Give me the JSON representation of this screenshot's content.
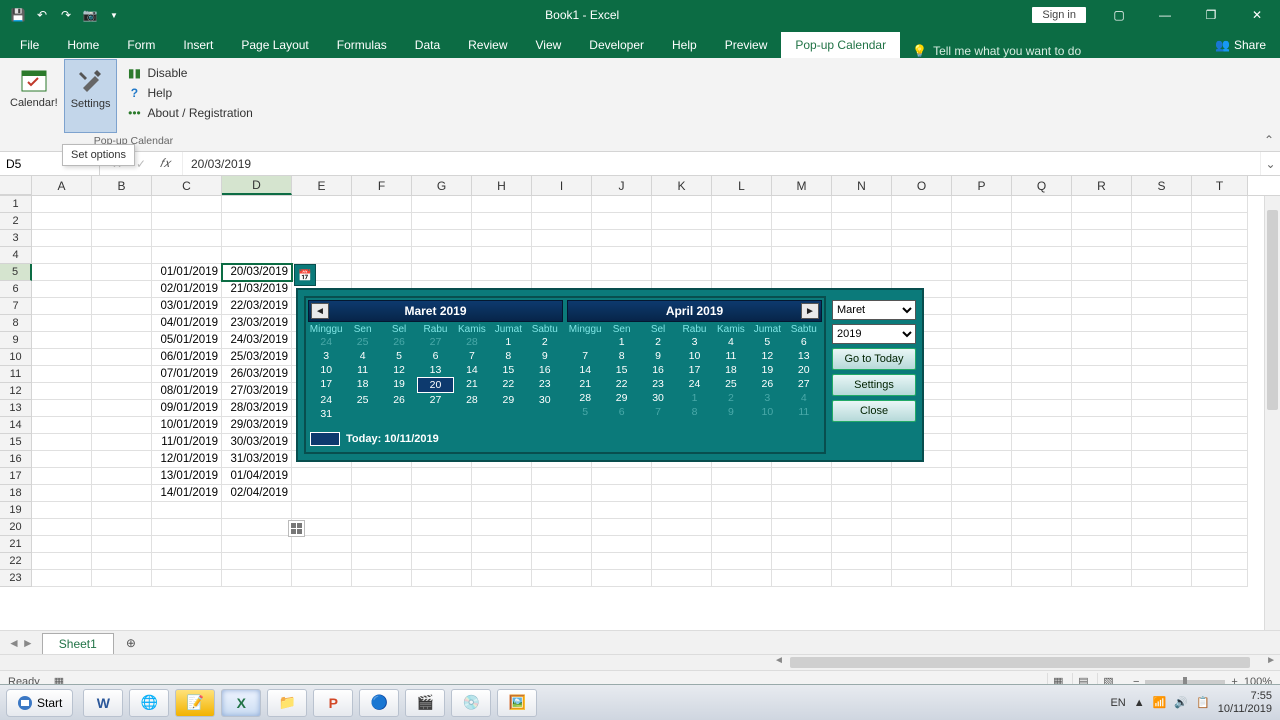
{
  "titlebar": {
    "title": "Book1 - Excel",
    "signin": "Sign in"
  },
  "tabs": {
    "file": "File",
    "items": [
      "Home",
      "Form",
      "Insert",
      "Page Layout",
      "Formulas",
      "Data",
      "Review",
      "View",
      "Developer",
      "Help",
      "Preview",
      "Pop-up Calendar"
    ],
    "active": "Pop-up Calendar",
    "tellme": "Tell me what you want to do",
    "share": "Share"
  },
  "ribbon": {
    "btn_calendar": "Calendar!",
    "btn_settings": "Settings",
    "menu_disable": "Disable",
    "menu_help": "Help",
    "menu_about": "About / Registration",
    "group_label": "Pop-up Calendar",
    "tooltip": "Set options"
  },
  "formula": {
    "namebox": "D5",
    "fx": "𝑓𝑥",
    "value": "20/03/2019"
  },
  "columns": [
    "A",
    "B",
    "C",
    "D",
    "E",
    "F",
    "G",
    "H",
    "I",
    "J",
    "K",
    "L",
    "M",
    "N",
    "O",
    "P",
    "Q",
    "R",
    "S",
    "T"
  ],
  "rows_count": 23,
  "selected": {
    "row": 5,
    "col": "D"
  },
  "cells": {
    "C5": "01/01/2019",
    "D5": "20/03/2019",
    "C6": "02/01/2019",
    "D6": "21/03/2019",
    "C7": "03/01/2019",
    "D7": "22/03/2019",
    "C8": "04/01/2019",
    "D8": "23/03/2019",
    "C9": "05/01/2019",
    "D9": "24/03/2019",
    "C10": "06/01/2019",
    "D10": "25/03/2019",
    "C11": "07/01/2019",
    "D11": "26/03/2019",
    "C12": "08/01/2019",
    "D12": "27/03/2019",
    "C13": "09/01/2019",
    "D13": "28/03/2019",
    "C14": "10/01/2019",
    "D14": "29/03/2019",
    "C15": "11/01/2019",
    "D15": "30/03/2019",
    "C16": "12/01/2019",
    "D16": "31/03/2019",
    "C17": "13/01/2019",
    "D17": "01/04/2019",
    "C18": "14/01/2019",
    "D18": "02/04/2019"
  },
  "calendar": {
    "month1": "Maret 2019",
    "month2": "April 2019",
    "weekdays": [
      "Minggu",
      "Sen",
      "Sel",
      "Rabu",
      "Kamis",
      "Jumat",
      "Sabtu"
    ],
    "m1": [
      [
        {
          "v": "24",
          "d": 1
        },
        {
          "v": "25",
          "d": 1
        },
        {
          "v": "26",
          "d": 1
        },
        {
          "v": "27",
          "d": 1
        },
        {
          "v": "28",
          "d": 1
        },
        {
          "v": "1"
        },
        {
          "v": "2"
        }
      ],
      [
        {
          "v": "3"
        },
        {
          "v": "4"
        },
        {
          "v": "5"
        },
        {
          "v": "6"
        },
        {
          "v": "7"
        },
        {
          "v": "8"
        },
        {
          "v": "9"
        }
      ],
      [
        {
          "v": "10"
        },
        {
          "v": "11"
        },
        {
          "v": "12"
        },
        {
          "v": "13"
        },
        {
          "v": "14"
        },
        {
          "v": "15"
        },
        {
          "v": "16"
        }
      ],
      [
        {
          "v": "17"
        },
        {
          "v": "18"
        },
        {
          "v": "19"
        },
        {
          "v": "20",
          "s": 1
        },
        {
          "v": "21"
        },
        {
          "v": "22"
        },
        {
          "v": "23"
        }
      ],
      [
        {
          "v": "24"
        },
        {
          "v": "25"
        },
        {
          "v": "26"
        },
        {
          "v": "27"
        },
        {
          "v": "28"
        },
        {
          "v": "29"
        },
        {
          "v": "30"
        }
      ],
      [
        {
          "v": "31"
        },
        {
          "v": ""
        },
        {
          "v": ""
        },
        {
          "v": ""
        },
        {
          "v": ""
        },
        {
          "v": ""
        },
        {
          "v": ""
        }
      ]
    ],
    "m2": [
      [
        {
          "v": ""
        },
        {
          "v": "1"
        },
        {
          "v": "2"
        },
        {
          "v": "3"
        },
        {
          "v": "4"
        },
        {
          "v": "5"
        },
        {
          "v": "6"
        }
      ],
      [
        {
          "v": "7"
        },
        {
          "v": "8"
        },
        {
          "v": "9"
        },
        {
          "v": "10"
        },
        {
          "v": "11"
        },
        {
          "v": "12"
        },
        {
          "v": "13"
        }
      ],
      [
        {
          "v": "14"
        },
        {
          "v": "15"
        },
        {
          "v": "16"
        },
        {
          "v": "17"
        },
        {
          "v": "18"
        },
        {
          "v": "19"
        },
        {
          "v": "20"
        }
      ],
      [
        {
          "v": "21"
        },
        {
          "v": "22"
        },
        {
          "v": "23"
        },
        {
          "v": "24"
        },
        {
          "v": "25"
        },
        {
          "v": "26"
        },
        {
          "v": "27"
        }
      ],
      [
        {
          "v": "28"
        },
        {
          "v": "29"
        },
        {
          "v": "30"
        },
        {
          "v": "1",
          "d": 1
        },
        {
          "v": "2",
          "d": 1
        },
        {
          "v": "3",
          "d": 1
        },
        {
          "v": "4",
          "d": 1
        }
      ],
      [
        {
          "v": "5",
          "d": 1
        },
        {
          "v": "6",
          "d": 1
        },
        {
          "v": "7",
          "d": 1
        },
        {
          "v": "8",
          "d": 1
        },
        {
          "v": "9",
          "d": 1
        },
        {
          "v": "10",
          "d": 1
        },
        {
          "v": "11",
          "d": 1
        }
      ]
    ],
    "month_select": "Maret",
    "year_select": "2019",
    "btn_today": "Go to Today",
    "btn_settings": "Settings",
    "btn_close": "Close",
    "today_label": "Today: 10/11/2019"
  },
  "sheet": {
    "name": "Sheet1"
  },
  "status": {
    "ready": "Ready",
    "zoom": "100%"
  },
  "taskbar": {
    "start": "Start",
    "lang": "EN",
    "time": "7:55",
    "date": "10/11/2019"
  }
}
